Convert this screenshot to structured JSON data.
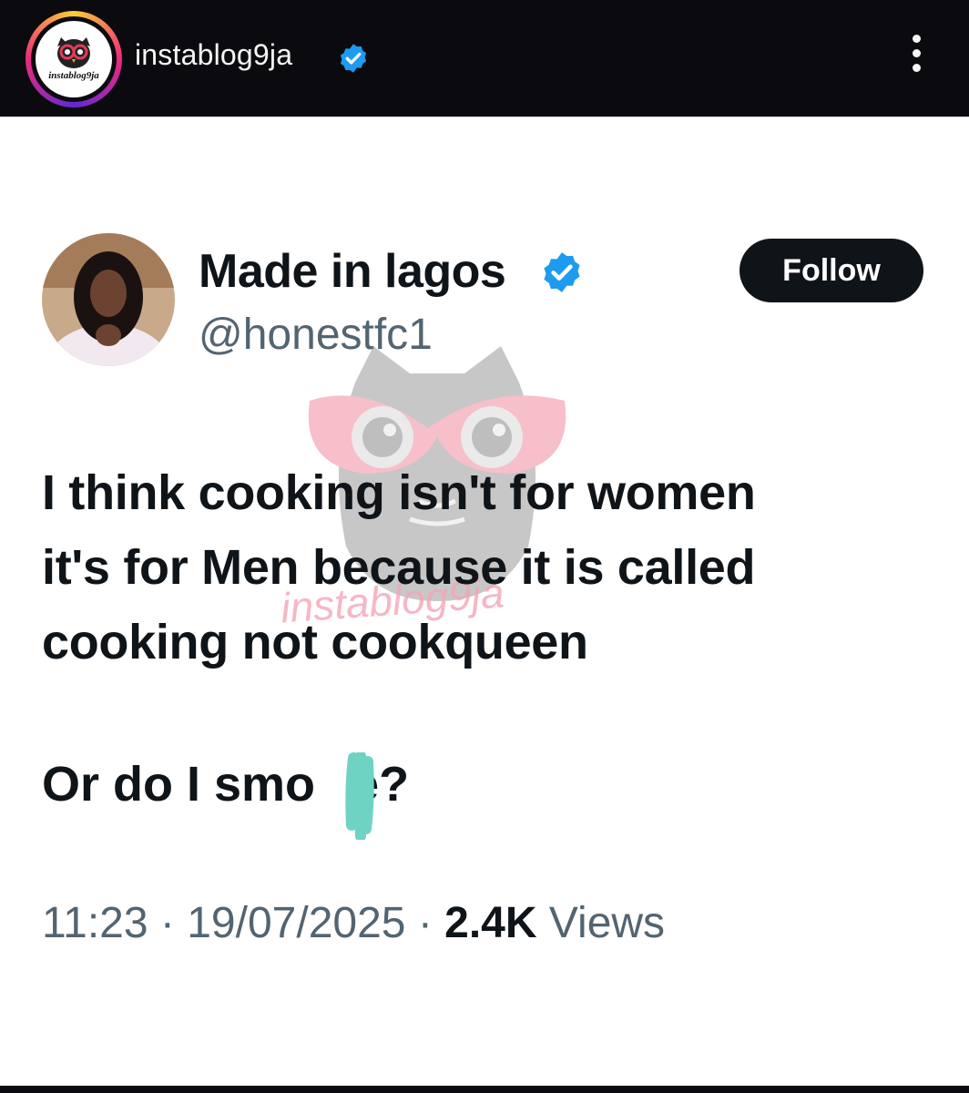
{
  "post_header": {
    "username": "instablog9ja",
    "avatar_text": "instablog9ja",
    "verified_icon": "verified-badge-icon",
    "more_icon": "more-vertical-icon"
  },
  "tweet": {
    "display_name": "Made in lagos",
    "handle": "@honestfc1",
    "follow_label": "Follow",
    "text_lines": [
      "I think cooking isn't for women",
      "it's for Men because it is called",
      "cooking not cookqueen"
    ],
    "text_line2_prefix": "Or do I smo",
    "text_line2_suffix": "e?",
    "time": "11:23",
    "separator": "·",
    "date": "19/07/2025",
    "views_count": "2.4K",
    "views_label": "Views",
    "watermark_text": "instablog9ja"
  },
  "colors": {
    "verified_blue": "#1d9bf0",
    "text_primary": "#0f1419",
    "text_secondary": "#536471",
    "scribble": "#6fd3c4"
  }
}
